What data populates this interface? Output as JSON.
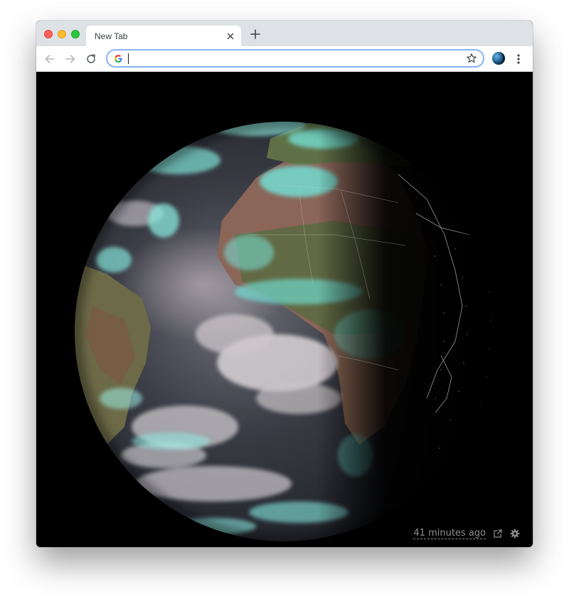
{
  "browser": {
    "tab": {
      "title": "New Tab"
    },
    "omnibox": {
      "value": "",
      "placeholder": ""
    }
  },
  "page": {
    "timestamp_text": "41 minutes ago"
  },
  "colors": {
    "tabstrip": "#dee1e6",
    "accent_focus": "#8ab4f8",
    "timestamp": "#8c8c8c"
  },
  "icons": [
    "back-arrow-icon",
    "forward-arrow-icon",
    "reload-icon",
    "google-g-icon",
    "bookmark-star-icon",
    "extension-earth-icon",
    "more-menu-icon",
    "open-external-icon",
    "settings-gear-icon",
    "close-icon",
    "plus-icon"
  ]
}
